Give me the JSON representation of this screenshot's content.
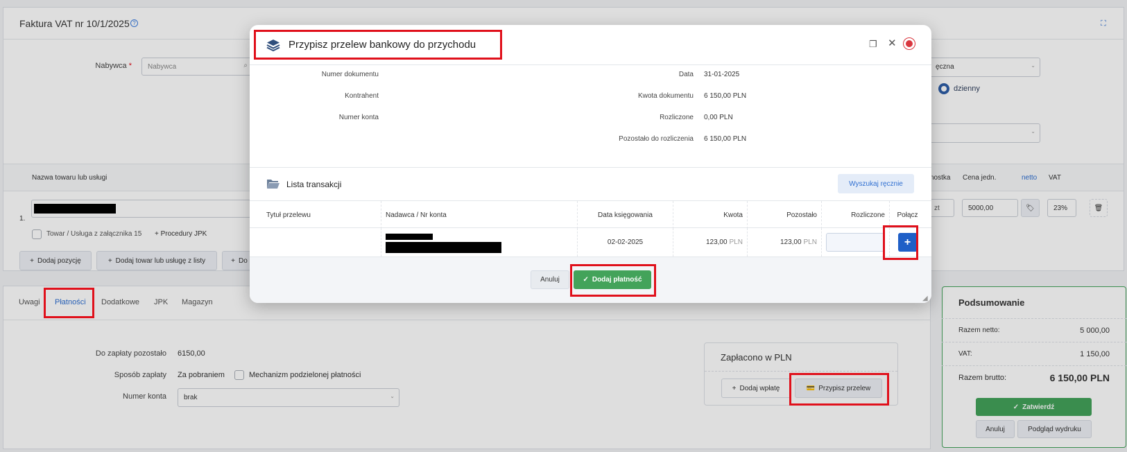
{
  "page": {
    "title": "Faktura VAT nr 10/1/2025",
    "buyer_label": "Nabywca",
    "buyer_placeholder": "Nabywca",
    "right_select_1": "ęczna",
    "radio_label": "dzienny"
  },
  "positions": {
    "col_name": "Nazwa towaru lub usługi",
    "col_unit": "nostka",
    "col_price": "Cena jedn.",
    "col_price_mode": "netto",
    "col_vat": "VAT",
    "row_number": "1.",
    "row_unit": "zt",
    "row_price": "5000,00",
    "row_vat": "23%",
    "attachment_label": "Towar / Usługa z załącznika 15",
    "jpk_procedures": "Procedury JPK",
    "add_position": "Dodaj pozycję",
    "add_from_list": "Dodaj towar lub usługę z listy",
    "add_more": "Do"
  },
  "tabs": [
    "Uwagi",
    "Płatności",
    "Dodatkowe",
    "JPK",
    "Magazyn"
  ],
  "payments": {
    "remaining_label": "Do zapłaty pozostało",
    "remaining_value": "6150,00",
    "method_label": "Sposób zapłaty",
    "method_value": "Za pobraniem",
    "split_label": "Mechanizm podzielonej płatności",
    "account_label": "Numer konta",
    "account_value": "brak",
    "paid_title": "Zapłacono w PLN",
    "add_payment": "Dodaj wpłatę",
    "assign_transfer": "Przypisz przelew"
  },
  "summary": {
    "title": "Podsumowanie",
    "net_label": "Razem netto:",
    "net_value": "5 000,00",
    "vat_label": "VAT:",
    "vat_value": "1 150,00",
    "gross_label": "Razem brutto:",
    "gross_value": "6 150,00 PLN",
    "approve": "Zatwierdź",
    "cancel": "Anuluj",
    "preview": "Podgląd wydruku"
  },
  "modal": {
    "title": "Przypisz przelew bankowy do przychodu",
    "left_labels": [
      "Numer dokumentu",
      "Kontrahent",
      "Numer konta"
    ],
    "right_labels": [
      "Data",
      "Kwota dokumentu",
      "Rozliczone",
      "Pozostało do rozliczenia"
    ],
    "right_values": [
      "31-01-2025",
      "6 150,00 PLN",
      "0,00 PLN",
      "6 150,00 PLN"
    ],
    "list_title": "Lista transakcji",
    "search_manual": "Wyszukaj ręcznie",
    "columns": [
      "Tytuł przelewu",
      "Nadawca / Nr konta",
      "Data księgowania",
      "Kwota",
      "Pozostało",
      "Rozliczone",
      "Połącz"
    ],
    "row": {
      "date": "02-02-2025",
      "amount": "123,00",
      "amount_currency": "PLN",
      "remaining": "123,00",
      "remaining_currency": "PLN"
    },
    "cancel": "Anuluj",
    "add_payment": "Dodaj płatność"
  },
  "colors": {
    "primary": "#2f6fd1",
    "green": "#43a35a",
    "highlight": "#e0101b"
  }
}
